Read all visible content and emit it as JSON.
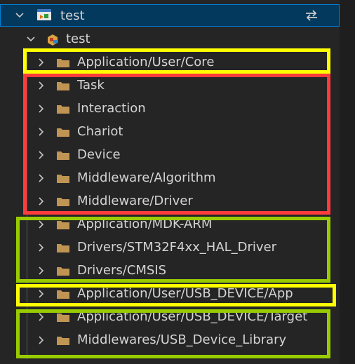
{
  "workspace": {
    "root_label": "test",
    "project_label": "test"
  },
  "tree": {
    "items": [
      {
        "label": "Application/User/Core"
      },
      {
        "label": "Task"
      },
      {
        "label": "Interaction"
      },
      {
        "label": "Chariot"
      },
      {
        "label": "Device"
      },
      {
        "label": "Middleware/Algorithm"
      },
      {
        "label": "Middleware/Driver"
      },
      {
        "label": "Application/MDK-ARM"
      },
      {
        "label": "Drivers/STM32F4xx_HAL_Driver"
      },
      {
        "label": "Drivers/CMSIS"
      },
      {
        "label": "Application/User/USB_DEVICE/App"
      },
      {
        "label": "Application/User/USB_DEVICE/Target"
      },
      {
        "label": "Middlewares/USB_Device_Library"
      }
    ]
  },
  "colors": {
    "highlight_yellow": "#ffff00",
    "highlight_red": "#ff3b3b",
    "highlight_green": "#99cc00",
    "folder": "#c09553",
    "selection": "#04395e"
  },
  "icons": {
    "root": "project-icon",
    "project": "target-icon",
    "folder": "folder-icon",
    "chevron": "chevron-right-icon",
    "sync": "sync-icon"
  }
}
